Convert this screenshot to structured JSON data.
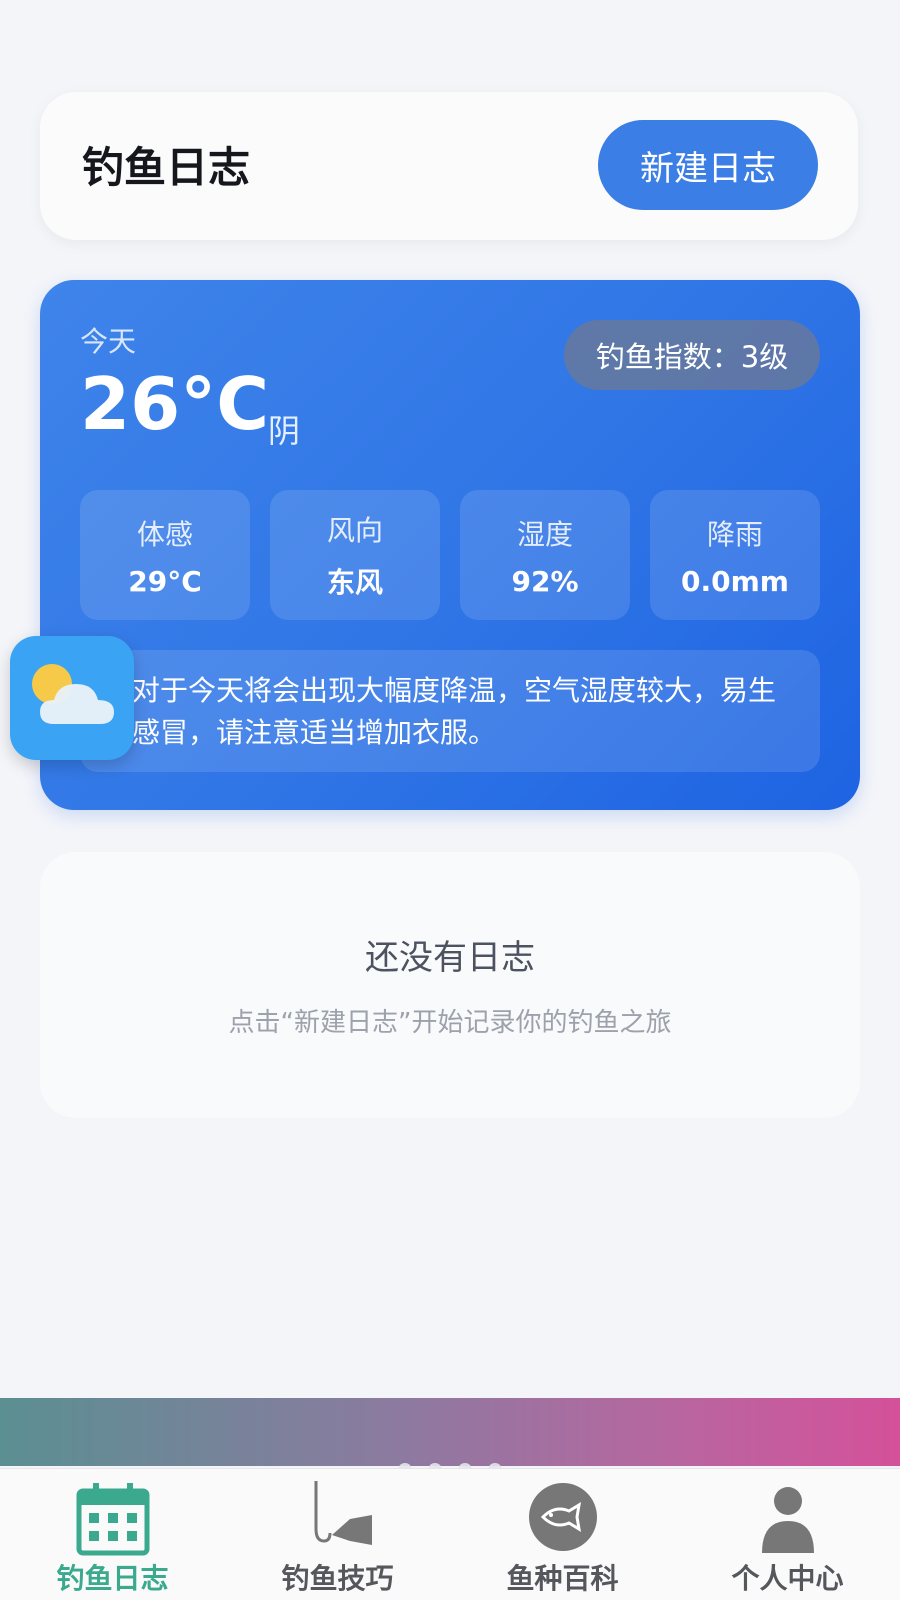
{
  "header": {
    "title": "钓鱼日志",
    "new_button_label": "新建日志"
  },
  "weather": {
    "day_label": "今天",
    "temperature": "26°C",
    "condition": "阴",
    "fishing_index": "钓鱼指数：3级",
    "stats": [
      {
        "label": "体感",
        "value": "29°C"
      },
      {
        "label": "风向",
        "value": "东风"
      },
      {
        "label": "湿度",
        "value": "92%"
      },
      {
        "label": "降雨",
        "value": "0.0mm"
      }
    ],
    "tip": "对于今天将会出现大幅度降温，空气湿度较大，易生感冒，请注意适当增加衣服。",
    "float_icon": "partly-cloudy-icon"
  },
  "empty_state": {
    "title": "还没有日志",
    "subtitle": "点击“新建日志”开始记录你的钓鱼之旅"
  },
  "banner": {
    "colors": [
      "#5b8f92",
      "#d4519a"
    ],
    "page_count": 4,
    "active_page": 1
  },
  "nav": {
    "active_color": "#3aa98e",
    "items": [
      {
        "label": "钓鱼日志",
        "icon": "calendar-icon",
        "active": true
      },
      {
        "label": "钓鱼技巧",
        "icon": "fishing-hook-icon",
        "active": false
      },
      {
        "label": "鱼种百科",
        "icon": "fish-icon",
        "active": false
      },
      {
        "label": "个人中心",
        "icon": "user-icon",
        "active": false
      }
    ]
  }
}
